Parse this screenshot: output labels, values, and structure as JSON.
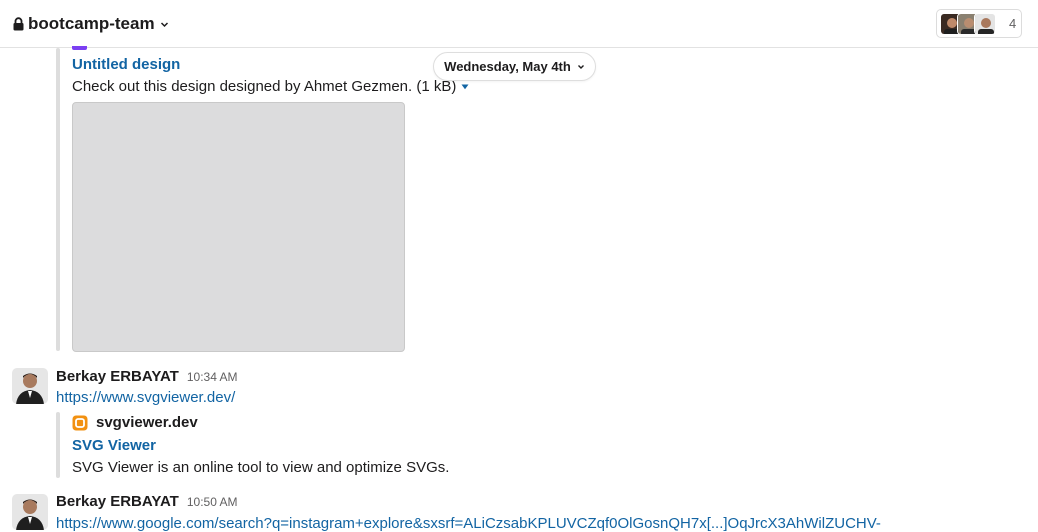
{
  "header": {
    "channel_name": "bootcamp-team",
    "member_count": "4"
  },
  "date_divider": {
    "label": "Wednesday, May 4th"
  },
  "attachment": {
    "title": "Untitled design",
    "description": "Check out this design designed by Ahmet Gezmen. (1 kB)"
  },
  "messages": [
    {
      "author": "Berkay ERBAYAT",
      "time": "10:34 AM",
      "link": "https://www.svgviewer.dev/",
      "unfurl": {
        "site": "svgviewer.dev",
        "title": "SVG Viewer",
        "description": "SVG Viewer is an online tool to view and optimize SVGs."
      }
    },
    {
      "author": "Berkay ERBAYAT",
      "time": "10:50 AM",
      "link": "https://www.google.com/search?q=instagram+explore&sxsrf=ALiCzsabKPLUVCZqf0OlGosnQH7x[...]OqJrcX3AhWilZUCHV-"
    }
  ],
  "colors": {
    "link": "#1264a3",
    "accent_purple": "#7b3ff2",
    "svgviewer_orange": "#f29111"
  }
}
